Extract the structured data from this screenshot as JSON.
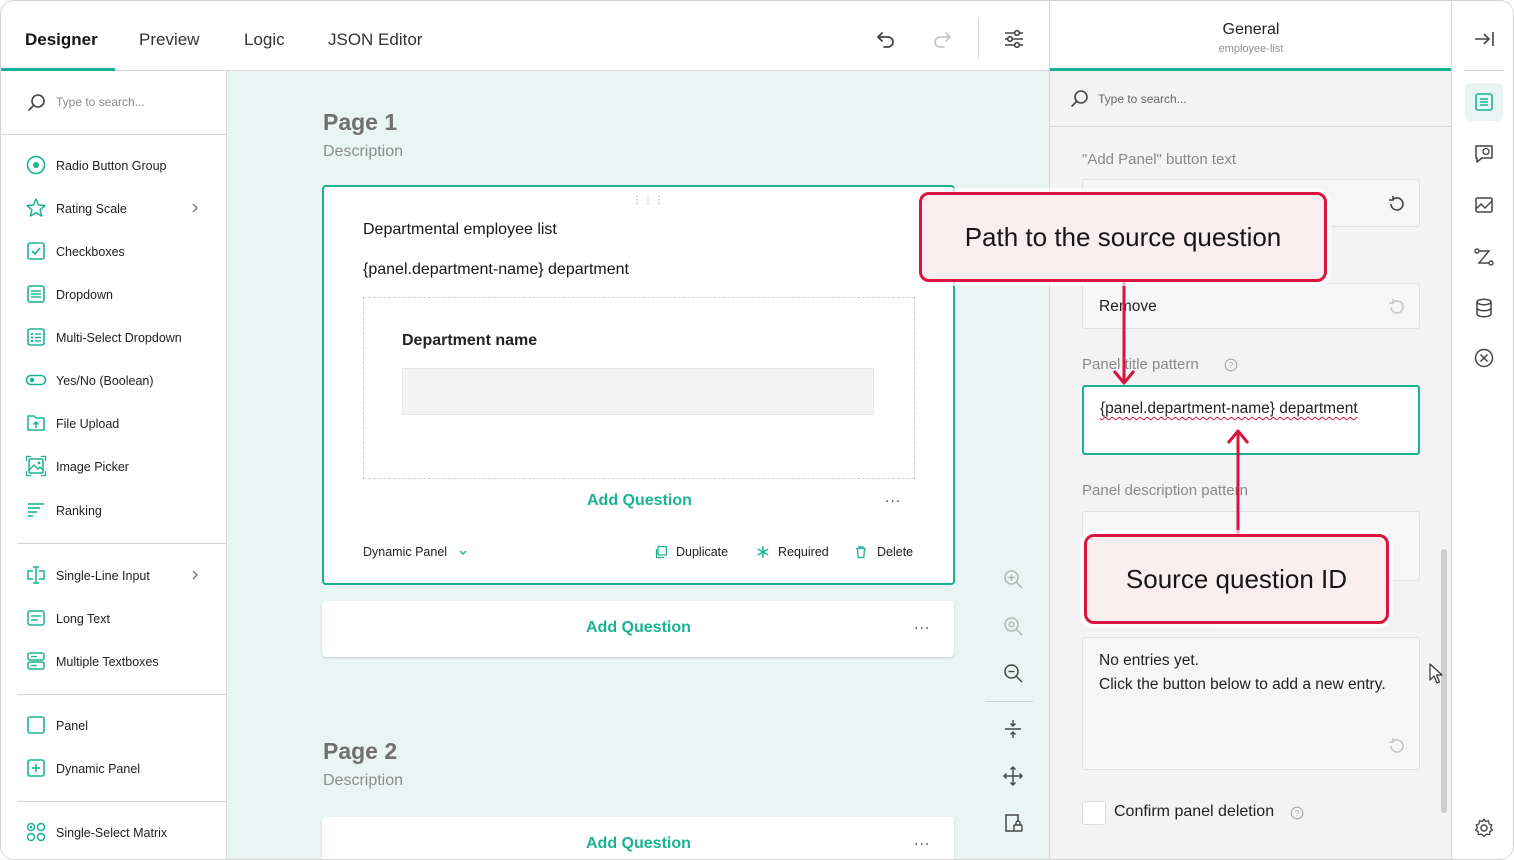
{
  "tabs": [
    {
      "label": "Designer"
    },
    {
      "label": "Preview"
    },
    {
      "label": "Logic"
    },
    {
      "label": "JSON Editor"
    }
  ],
  "toolbox": {
    "search_placeholder": "Type to search...",
    "items": [
      {
        "label": "Radio Button Group",
        "icon": "radio-icon"
      },
      {
        "label": "Rating Scale",
        "icon": "star-icon"
      },
      {
        "label": "Checkboxes",
        "icon": "checkbox-icon"
      },
      {
        "label": "Dropdown",
        "icon": "dropdown-icon"
      },
      {
        "label": "Multi-Select Dropdown",
        "icon": "multi-dropdown-icon"
      },
      {
        "label": "Yes/No (Boolean)",
        "icon": "toggle-icon"
      },
      {
        "label": "File Upload",
        "icon": "file-upload-icon"
      },
      {
        "label": "Image Picker",
        "icon": "image-icon"
      },
      {
        "label": "Ranking",
        "icon": "ranking-icon"
      },
      {
        "label": "Single-Line Input",
        "icon": "text-cursor-icon"
      },
      {
        "label": "Long Text",
        "icon": "long-text-icon"
      },
      {
        "label": "Multiple Textboxes",
        "icon": "multi-text-icon"
      },
      {
        "label": "Panel",
        "icon": "panel-icon"
      },
      {
        "label": "Dynamic Panel",
        "icon": "dynamic-panel-icon"
      },
      {
        "label": "Single-Select Matrix",
        "icon": "matrix-icon"
      }
    ]
  },
  "canvas": {
    "page1": {
      "title": "Page 1",
      "description": "Description"
    },
    "page2": {
      "title": "Page 2",
      "description": "Description"
    },
    "panel": {
      "title": "Departmental employee list",
      "title_pattern_preview": "{panel.department-name} department",
      "inner_question": "Department name",
      "add_question": "Add Question",
      "type_label": "Dynamic Panel",
      "duplicate": "Duplicate",
      "required": "Required",
      "delete": "Delete"
    },
    "add_question": "Add Question",
    "more": "..."
  },
  "props": {
    "title": "General",
    "subtitle": "employee-list",
    "search_placeholder": "Type to search...",
    "add_panel_label": "\"Add Panel\" button text",
    "remove_value": "Remove",
    "title_pattern_label": "Panel title pattern",
    "title_pattern_value": "{panel.department-name} department",
    "desc_pattern_label": "Panel description pattern",
    "empty_text": "No entries yet.\nClick the button below to add a new entry.",
    "confirm_label": "Confirm panel deletion"
  },
  "callouts": {
    "path": "Path to the source question",
    "source": "Source question ID"
  },
  "colors": {
    "accent": "#19b394",
    "callout_border": "#d9143f",
    "canvas_bg": "#e8f5f2"
  }
}
